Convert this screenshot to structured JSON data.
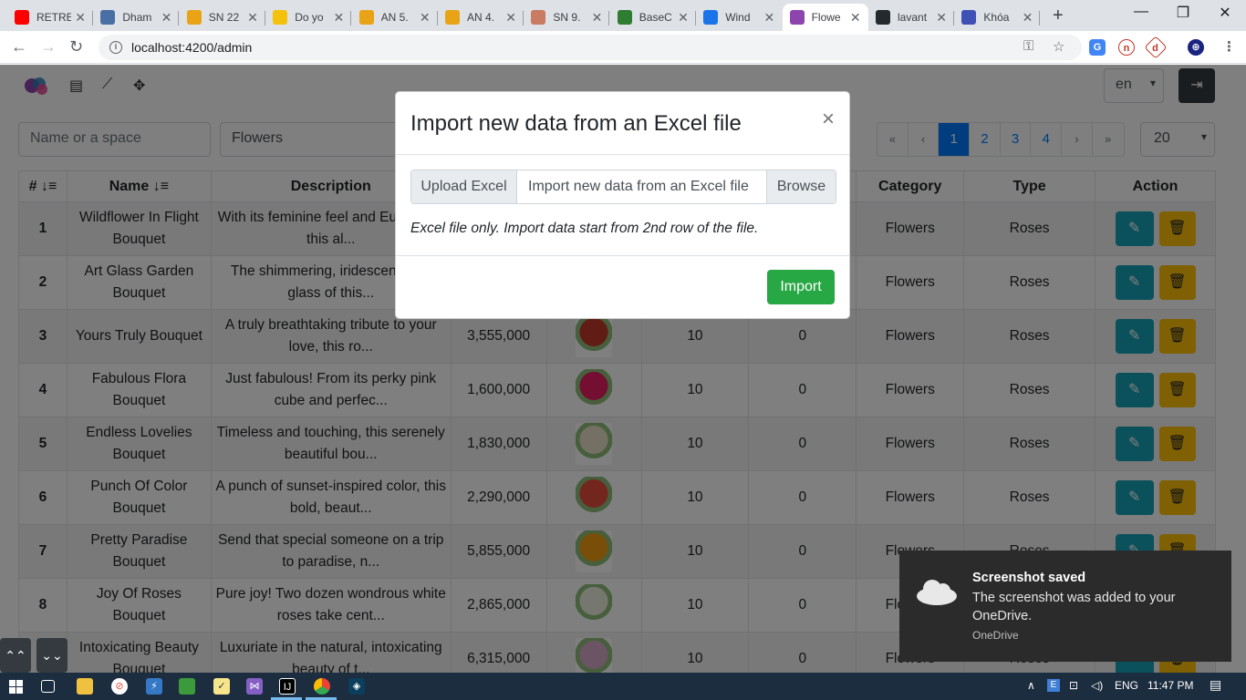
{
  "browser": {
    "tabs": [
      {
        "title": "RETRE",
        "color": "#ff0000"
      },
      {
        "title": "Dham",
        "color": "#4a6fa5"
      },
      {
        "title": "SN 22",
        "color": "#e8a317"
      },
      {
        "title": "Do yo",
        "color": "#f4c20d"
      },
      {
        "title": "AN 5.",
        "color": "#e8a317"
      },
      {
        "title": "AN 4.",
        "color": "#e8a317"
      },
      {
        "title": "SN 9.",
        "color": "#c97b63"
      },
      {
        "title": "BaseC",
        "color": "#2e7d32"
      },
      {
        "title": "Wind",
        "color": "#1a73e8"
      },
      {
        "title": "Flowe",
        "color": "#8e44ad"
      },
      {
        "title": "lavant",
        "color": "#24292e"
      },
      {
        "title": "Khóa",
        "color": "#3f51b5"
      }
    ],
    "active_tab_index": 9,
    "url": "localhost:4200/admin",
    "win_minimize": "—",
    "win_restore": "❐",
    "win_close": "✕"
  },
  "app": {
    "lang_value": "en",
    "filter_name_placeholder": "Name or a space",
    "filter_category_value": "Flowers",
    "pagination": [
      "«",
      "‹",
      "1",
      "2",
      "3",
      "4",
      "›",
      "»"
    ],
    "active_page": "1",
    "page_size": "20",
    "columns": [
      "# ↓≡",
      "Name ↓≡",
      "Description",
      "",
      "",
      "",
      "",
      "Category",
      "Type",
      "Action"
    ],
    "rows": [
      {
        "num": "1",
        "name": "Wildflower In Flight Bouquet",
        "desc": "With its feminine feel and Eu charm, this al...",
        "price": "",
        "qty": "",
        "sold": "",
        "category": "Flowers",
        "type": "Roses",
        "thumb": ""
      },
      {
        "num": "2",
        "name": "Art Glass Garden Bouquet",
        "desc": "The shimmering, iridescent blue glass of this...",
        "price": "",
        "qty": "",
        "sold": "",
        "category": "Flowers",
        "type": "Roses",
        "thumb": ""
      },
      {
        "num": "3",
        "name": "Yours Truly Bouquet",
        "desc": "A truly breathtaking tribute to your love, this ro...",
        "price": "3,555,000",
        "qty": "10",
        "sold": "0",
        "category": "Flowers",
        "type": "Roses",
        "thumb": "#c0392b"
      },
      {
        "num": "4",
        "name": "Fabulous Flora Bouquet",
        "desc": "Just fabulous! From its perky pink cube and perfec...",
        "price": "1,600,000",
        "qty": "10",
        "sold": "0",
        "category": "Flowers",
        "type": "Roses",
        "thumb": "#e91e63"
      },
      {
        "num": "5",
        "name": "Endless Lovelies Bouquet",
        "desc": "Timeless and touching, this serenely beautiful bou...",
        "price": "1,830,000",
        "qty": "10",
        "sold": "0",
        "category": "Flowers",
        "type": "Roses",
        "thumb": "#e8e0c8"
      },
      {
        "num": "6",
        "name": "Punch Of Color Bouquet",
        "desc": "A punch of sunset-inspired color, this bold, beaut...",
        "price": "2,290,000",
        "qty": "10",
        "sold": "0",
        "category": "Flowers",
        "type": "Roses",
        "thumb": "#e74c3c"
      },
      {
        "num": "7",
        "name": "Pretty Paradise Bouquet",
        "desc": "Send that special someone on a trip to paradise, n...",
        "price": "5,855,000",
        "qty": "10",
        "sold": "0",
        "category": "Flowers",
        "type": "Roses",
        "thumb": "#f39c12"
      },
      {
        "num": "8",
        "name": "Joy Of Roses Bouquet",
        "desc": "Pure joy! Two dozen wondrous white roses take cent...",
        "price": "2,865,000",
        "qty": "10",
        "sold": "0",
        "category": "Flowers",
        "type": "Roses",
        "thumb": "#ecf0e1"
      },
      {
        "num": "9",
        "name": "Intoxicating Beauty Bouquet",
        "desc": "Luxuriate in the natural, intoxicating beauty of t...",
        "price": "6,315,000",
        "qty": "10",
        "sold": "0",
        "category": "Flowers",
        "type": "Roses",
        "thumb": "#d7a9c9"
      }
    ],
    "edit_icon": "✎",
    "delete_icon": "🗑"
  },
  "modal": {
    "title": "Import new data from an Excel file",
    "close": "×",
    "upload_prefix": "Upload Excel",
    "file_placeholder": "Import new data from an Excel file",
    "browse": "Browse",
    "hint": "Excel file only. Import data start from 2nd row of the file.",
    "import_button": "Import"
  },
  "fab": {
    "up": "⌃⌃",
    "down": "⌄⌄"
  },
  "toast": {
    "title": "Screenshot saved",
    "message": "The screenshot was added to your OneDrive.",
    "source": "OneDrive"
  },
  "taskbar": {
    "lang": "ENG",
    "time": "11:47 PM"
  }
}
